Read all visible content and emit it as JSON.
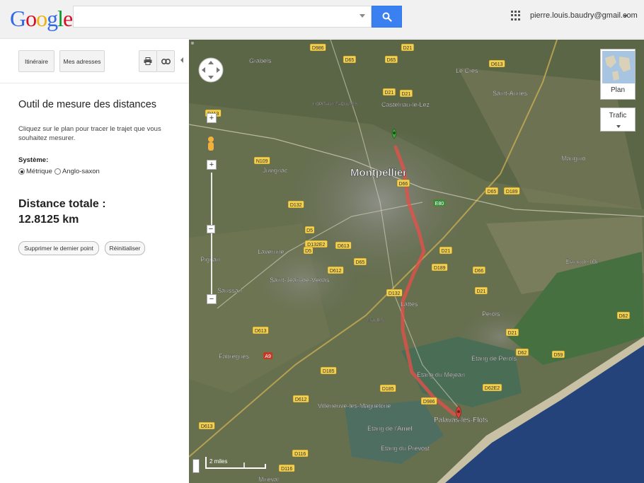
{
  "header": {
    "logo_letters": [
      {
        "ch": "G",
        "color": "#3369e8"
      },
      {
        "ch": "o",
        "color": "#d50f25"
      },
      {
        "ch": "o",
        "color": "#eeb211"
      },
      {
        "ch": "g",
        "color": "#3369e8"
      },
      {
        "ch": "l",
        "color": "#009925"
      },
      {
        "ch": "e",
        "color": "#d50f25"
      }
    ],
    "search": {
      "value": "",
      "placeholder": ""
    },
    "account_email": "pierre.louis.baudry@gmail.com",
    "search_button_color": "#3b80f0"
  },
  "panel": {
    "toolbar": {
      "itinerary_label": "Itinéraire",
      "addresses_label": "Mes adresses",
      "print_icon": "printer-icon",
      "link_icon": "link-icon"
    },
    "tool": {
      "title": "Outil de mesure des distances",
      "description": "Cliquez sur le plan pour tracer le trajet que vous souhaitez mesurer.",
      "system_label": "Système:",
      "option_metric": "Métrique",
      "option_imperial": "Anglo-saxon",
      "selected": "metric",
      "distance_label": "Distance totale :",
      "distance_value": "12.8125 km",
      "remove_last_label": "Supprimer le dernier point",
      "reset_label": "Réinitialiser"
    }
  },
  "map": {
    "controls": {
      "plan_label": "Plan",
      "traffic_label": "Trafic",
      "zoom_in": "+",
      "zoom_out": "−",
      "scale_label": "2 miles"
    },
    "places": [
      {
        "id": "montpellier",
        "label": "Montpellier"
      },
      {
        "id": "grabels",
        "label": "Grabels"
      },
      {
        "id": "castelnau",
        "label": "Castelnau-le-Lez"
      },
      {
        "id": "lecres",
        "label": "Le Crès"
      },
      {
        "id": "saintaunes",
        "label": "Saint-Aunès"
      },
      {
        "id": "mauguio",
        "label": "Mauguio"
      },
      {
        "id": "juvignac",
        "label": "Juvignac"
      },
      {
        "id": "laverune",
        "label": "Lavérune"
      },
      {
        "id": "pignan",
        "label": "Pignan"
      },
      {
        "id": "saintjean",
        "label": "Saint-Jean-de-Védas"
      },
      {
        "id": "saussan",
        "label": "Saussan"
      },
      {
        "id": "lattes",
        "label": "Lattes"
      },
      {
        "id": "perols",
        "label": "Pérols"
      },
      {
        "id": "fabregues",
        "label": "Fabrègues"
      },
      {
        "id": "villeneuve",
        "label": "Villeneuve-lès-Maguelone"
      },
      {
        "id": "etangmejean",
        "label": "Étang du Méjean"
      },
      {
        "id": "etangperols",
        "label": "Étang de Pérols"
      },
      {
        "id": "etangarnel",
        "label": "Étang de l'Arnel"
      },
      {
        "id": "etangprevost",
        "label": "Étang du Prévost"
      },
      {
        "id": "palavas",
        "label": "Palavas-les-Flots"
      },
      {
        "id": "etangor",
        "label": "Étang de l'Or"
      },
      {
        "id": "mireval",
        "label": "Mireval"
      },
      {
        "id": "facultes",
        "label": "HOPITAUX-FACULTES"
      },
      {
        "id": "mauriin",
        "label": "MAURIN"
      }
    ],
    "roads": [
      "D986",
      "D65",
      "D65",
      "D21",
      "D613",
      "D21",
      "D113",
      "D65",
      "D21",
      "N109",
      "D5",
      "D132",
      "D132E2",
      "D613",
      "D66",
      "D189",
      "E80",
      "D5",
      "D612",
      "D65",
      "D21",
      "D189",
      "D66",
      "D21",
      "D132",
      "D62",
      "D613",
      "D21",
      "D62",
      "D59",
      "D185",
      "D185",
      "D612",
      "D986",
      "D62E2",
      "D613",
      "D116",
      "D116",
      "A9"
    ],
    "route_color": "#e84f4a",
    "start_marker_color": "#3ea63b",
    "end_marker_color": "#d6453d"
  }
}
